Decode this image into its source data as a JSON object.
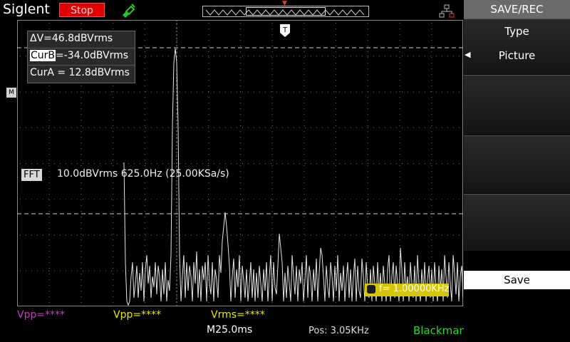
{
  "brand": "Siglent",
  "run_state": "Stop",
  "markers": {
    "m": "M",
    "t": "T"
  },
  "cursor": {
    "delta": "ΔV=46.8dBVrms",
    "curb_tag": "CurB",
    "curb_value": "=-34.0dBVrms",
    "cura": "CurA = 12.8dBVrms"
  },
  "fft": {
    "tag": "FFT",
    "info": "10.0dBVrms   625.0Hz (25.00KSa/s)"
  },
  "trigger": {
    "text": "f= 1.00000KHz"
  },
  "measurements": {
    "m1": "Vpp=****",
    "m2": "Vpp=****",
    "m3": "Vrms=****"
  },
  "timebase": "M25.0ms",
  "position": "Pos: 3.05KHz",
  "window_fn": "Blackman",
  "menu": {
    "title": "SAVE/REC",
    "type_label": "Type",
    "type_value": "Picture",
    "save_label": "Save"
  },
  "colors": {
    "stop": "#e00000",
    "ch_purple": "#c83cc8",
    "ch_yellow": "#e8e800",
    "window_green": "#22dd22"
  },
  "icons": [
    "probe-icon",
    "network-icon",
    "trigger-icon"
  ]
}
